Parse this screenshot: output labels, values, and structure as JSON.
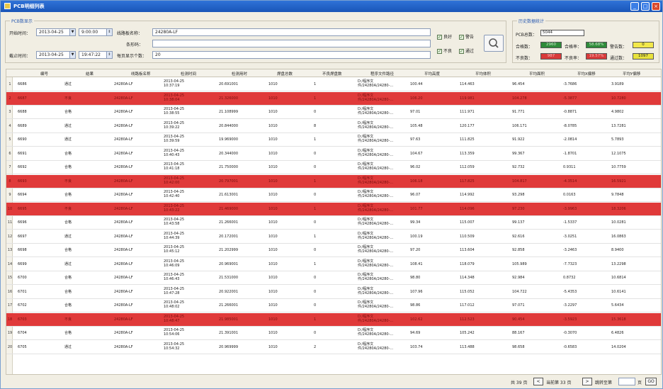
{
  "window": {
    "title": "PCB明细列表",
    "btn_min": "_",
    "btn_max": "□",
    "btn_close": "×"
  },
  "query": {
    "legend": "PCB数显示",
    "start_label": "开始时间：",
    "start_date": "2013-04-25",
    "start_time": "9:00:00",
    "end_label": "截止时间：",
    "end_date": "2013-04-25",
    "end_time": "19:47:22",
    "board_name_label": "线路板名称：",
    "board_name_value": "24280A-LF",
    "barcode_label": "条形码：",
    "barcode_value": "",
    "per_page_label": "每页显示个数：",
    "per_page_value": "20",
    "chk_good": "良好",
    "chk_warn": "警告",
    "chk_bad": "不良",
    "chk_pass": "通过"
  },
  "stats": {
    "legend": "历史数据统计",
    "pcb_total_label": "PCB总数：",
    "pcb_total": "5044",
    "good_label": "合格数：",
    "good_value": "2960",
    "good_rate_label": "合格率：",
    "good_rate_value": "58.68%",
    "warn_label": "警告数：",
    "warn_value": "0",
    "bad_label": "不良数：",
    "bad_value": "987",
    "bad_rate_label": "不良率：",
    "bad_rate_value": "19.57%",
    "pass_label": "通过数：",
    "pass_value": "1097",
    "color_good": "#2e8b3a",
    "color_warn": "#f2e84a",
    "color_bad": "#d83a3a",
    "color_pass": "#e8e23c"
  },
  "table": {
    "columns": [
      "编号",
      "结果",
      "线路板名称",
      "检测时间",
      "检测用时",
      "焊盘总数",
      "不良焊盘数",
      "程序文件路径",
      "平均高度",
      "平均体积",
      "平均面积",
      "平均X偏移",
      "平均Y偏移"
    ],
    "rows": [
      {
        "n": "1",
        "id": "6686",
        "result": "通过",
        "name": "24280A-LF",
        "date": "2013-04-25",
        "time": "10:37:19",
        "dur": "20.691001",
        "pads": "1010",
        "bad": "1",
        "path1": "D:/程序文",
        "path2": "件/24280A/24280-…",
        "h": "100.44",
        "v": "114.463",
        "a": "96.454",
        "x": "-3.7686",
        "y": "3.9189",
        "ng": false
      },
      {
        "n": "2",
        "id": "6687",
        "result": "不良",
        "name": "24280A-LF",
        "date": "2013-04-25",
        "time": "10:38:04",
        "dur": "21.326000",
        "pads": "1010",
        "bad": "1",
        "path1": "D:/程序文",
        "path2": "件/24280A/24280-…",
        "h": "106.20",
        "v": "119.981",
        "a": "104.278",
        "x": "-5.3877",
        "y": "10.7280",
        "ng": true
      },
      {
        "n": "3",
        "id": "6688",
        "result": "合格",
        "name": "24280A-LF",
        "date": "2013-04-25",
        "time": "10:38:55",
        "dur": "21.108999",
        "pads": "1010",
        "bad": "0",
        "path1": "D:/程序文",
        "path2": "件/24280A/24280-…",
        "h": "97.01",
        "v": "111.971",
        "a": "91.771",
        "x": "-0.8871",
        "y": "4.9802",
        "ng": false
      },
      {
        "n": "4",
        "id": "6689",
        "result": "通过",
        "name": "24280A-LF",
        "date": "2013-04-25",
        "time": "10:39:22",
        "dur": "20.844000",
        "pads": "1010",
        "bad": "8",
        "path1": "D:/程序文",
        "path2": "件/24280A/24280-…",
        "h": "105.48",
        "v": "120.177",
        "a": "106.171",
        "x": "-8.0785",
        "y": "13.7281",
        "ng": false
      },
      {
        "n": "5",
        "id": "6690",
        "result": "通过",
        "name": "24280A-LF",
        "date": "2013-04-25",
        "time": "10:39:59",
        "dur": "19.969000",
        "pads": "1010",
        "bad": "1",
        "path1": "D:/程序文",
        "path2": "件/24280A/24280-…",
        "h": "97.63",
        "v": "111.825",
        "a": "91.922",
        "x": "-2.0814",
        "y": "5.7893",
        "ng": false
      },
      {
        "n": "6",
        "id": "6691",
        "result": "合格",
        "name": "24280A-LF",
        "date": "2013-04-25",
        "time": "10:40:43",
        "dur": "20.344000",
        "pads": "1010",
        "bad": "0",
        "path1": "D:/程序文",
        "path2": "件/24280A/24280-…",
        "h": "104.67",
        "v": "113.359",
        "a": "99.367",
        "x": "-1.8701",
        "y": "12.1075",
        "ng": false
      },
      {
        "n": "7",
        "id": "6692",
        "result": "合格",
        "name": "24280A-LF",
        "date": "2013-04-25",
        "time": "10:41:18",
        "dur": "21.750000",
        "pads": "1010",
        "bad": "0",
        "path1": "D:/程序文",
        "path2": "件/24280A/24280-…",
        "h": "96.02",
        "v": "112.059",
        "a": "92.732",
        "x": "0.9311",
        "y": "10.7759",
        "ng": false
      },
      {
        "n": "8",
        "id": "6693",
        "result": "不良",
        "name": "24280A-LF",
        "date": "2013-04-25",
        "time": "10:42:00",
        "dur": "20.797001",
        "pads": "1010",
        "bad": "1",
        "path1": "D:/程序文",
        "path2": "件/24280A/24280-…",
        "h": "106.18",
        "v": "117.825",
        "a": "104.817",
        "x": "-4.3514",
        "y": "16.5921",
        "ng": true
      },
      {
        "n": "9",
        "id": "6694",
        "result": "合格",
        "name": "24280A-LF",
        "date": "2013-04-25",
        "time": "10:42:40",
        "dur": "21.613001",
        "pads": "1010",
        "bad": "0",
        "path1": "D:/程序文",
        "path2": "件/24280A/24280-…",
        "h": "96.07",
        "v": "114.992",
        "a": "93.298",
        "x": "0.0163",
        "y": "9.7848",
        "ng": false
      },
      {
        "n": "10",
        "id": "6695",
        "result": "不良",
        "name": "24280A-LF",
        "date": "2013-04-25",
        "time": "10:43:22",
        "dur": "21.469000",
        "pads": "1010",
        "bad": "1",
        "path1": "D:/程序文",
        "path2": "件/24280A/24280-…",
        "h": "101.77",
        "v": "114.096",
        "a": "97.230",
        "x": "-3.9963",
        "y": "18.3206",
        "ng": true
      },
      {
        "n": "11",
        "id": "6696",
        "result": "合格",
        "name": "24280A-LF",
        "date": "2013-04-25",
        "time": "10:43:58",
        "dur": "21.266001",
        "pads": "1010",
        "bad": "0",
        "path1": "D:/程序文",
        "path2": "件/24280A/24280-…",
        "h": "99.34",
        "v": "115.007",
        "a": "99.137",
        "x": "-1.5337",
        "y": "10.0281",
        "ng": false
      },
      {
        "n": "12",
        "id": "6697",
        "result": "通过",
        "name": "24280A-LF",
        "date": "2013-04-25",
        "time": "10:44:39",
        "dur": "20.172001",
        "pads": "1010",
        "bad": "1",
        "path1": "D:/程序文",
        "path2": "件/24280A/24280-…",
        "h": "100.19",
        "v": "110.509",
        "a": "92.616",
        "x": "-3.0251",
        "y": "16.0863",
        "ng": false
      },
      {
        "n": "13",
        "id": "6698",
        "result": "合格",
        "name": "24280A-LF",
        "date": "2013-04-25",
        "time": "10:45:12",
        "dur": "21.202999",
        "pads": "1010",
        "bad": "0",
        "path1": "D:/程序文",
        "path2": "件/24280A/24280-…",
        "h": "97.20",
        "v": "113.604",
        "a": "92.858",
        "x": "-3.2463",
        "y": "8.9400",
        "ng": false
      },
      {
        "n": "14",
        "id": "6699",
        "result": "通过",
        "name": "24280A-LF",
        "date": "2013-04-25",
        "time": "10:46:09",
        "dur": "20.969001",
        "pads": "1010",
        "bad": "1",
        "path1": "D:/程序文",
        "path2": "件/24280A/24280-…",
        "h": "108.41",
        "v": "118.079",
        "a": "105.989",
        "x": "-7.7323",
        "y": "13.2298",
        "ng": false
      },
      {
        "n": "15",
        "id": "6700",
        "result": "合格",
        "name": "24280A-LF",
        "date": "2013-04-25",
        "time": "10:46:43",
        "dur": "21.531000",
        "pads": "1010",
        "bad": "0",
        "path1": "D:/程序文",
        "path2": "件/24280A/24280-…",
        "h": "98.80",
        "v": "114.348",
        "a": "92.984",
        "x": "0.8732",
        "y": "10.6814",
        "ng": false
      },
      {
        "n": "16",
        "id": "6701",
        "result": "合格",
        "name": "24280A-LF",
        "date": "2013-04-25",
        "time": "10:47:28",
        "dur": "20.922001",
        "pads": "1010",
        "bad": "0",
        "path1": "D:/程序文",
        "path2": "件/24280A/24280-…",
        "h": "107.96",
        "v": "115.052",
        "a": "104.722",
        "x": "-5.4353",
        "y": "10.6141",
        "ng": false
      },
      {
        "n": "17",
        "id": "6702",
        "result": "合格",
        "name": "24280A-LF",
        "date": "2013-04-25",
        "time": "10:48:02",
        "dur": "21.266001",
        "pads": "1010",
        "bad": "0",
        "path1": "D:/程序文",
        "path2": "件/24280A/24280-…",
        "h": "98.86",
        "v": "117.012",
        "a": "97.071",
        "x": "-3.2297",
        "y": "5.6434",
        "ng": false
      },
      {
        "n": "18",
        "id": "6703",
        "result": "不良",
        "name": "24280A-LF",
        "date": "2013-04-25",
        "time": "10:48:47",
        "dur": "21.985001",
        "pads": "1010",
        "bad": "1",
        "path1": "D:/程序文",
        "path2": "件/24280A/24280-…",
        "h": "102.62",
        "v": "112.523",
        "a": "90.454",
        "x": "-3.5923",
        "y": "15.3618",
        "ng": true
      },
      {
        "n": "19",
        "id": "6704",
        "result": "合格",
        "name": "24280A-LF",
        "date": "2013-04-25",
        "time": "10:54:06",
        "dur": "21.391001",
        "pads": "1010",
        "bad": "0",
        "path1": "D:/程序文",
        "path2": "件/24280A/24280-…",
        "h": "94.69",
        "v": "105.242",
        "a": "88.167",
        "x": "-0.3070",
        "y": "6.4826",
        "ng": false
      },
      {
        "n": "20",
        "id": "6705",
        "result": "通过",
        "name": "24280A-LF",
        "date": "2013-04-25",
        "time": "10:54:32",
        "dur": "20.969999",
        "pads": "1010",
        "bad": "2",
        "path1": "D:/程序文",
        "path2": "件/24280A/24280-…",
        "h": "103.74",
        "v": "113.488",
        "a": "98.658",
        "x": "-0.6583",
        "y": "14.0204",
        "ng": false
      }
    ]
  },
  "pager": {
    "total_label": "共 39 页",
    "prev": "<",
    "current_label": "当前第 33 页",
    "next": ">",
    "jump_label": "跳转至第",
    "page_unit": "页",
    "go": "GO"
  }
}
